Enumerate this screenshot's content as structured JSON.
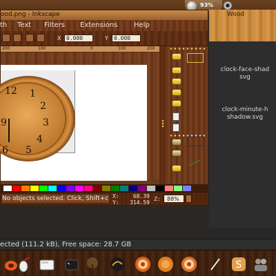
{
  "top_panel": {
    "battery_percent": "93%",
    "accent": "#6a4222"
  },
  "wood_window": {
    "title": "Wood",
    "files": [
      {
        "line1": "clock-face-shad",
        "line2": "svg"
      },
      {
        "line1": "clock-minute-h",
        "line2": "shadow.svg"
      }
    ]
  },
  "inkscape": {
    "title": "ood.png - Inkscape",
    "menu": [
      "th",
      "Text",
      "Filters",
      "Extensions",
      "Help"
    ],
    "toolbar": {
      "x_label": "X",
      "x_value": "0.000",
      "y_label": "Y",
      "y_value": "0.000"
    },
    "ruler": {
      "ticks": [
        "200",
        "100",
        "0",
        "100",
        "200"
      ]
    },
    "clock": {
      "numbers": [
        "12",
        "1",
        "2",
        "3",
        "4",
        "5",
        "6",
        "9"
      ]
    },
    "palette": [
      "#ffffff",
      "#ff0000",
      "#ff8000",
      "#ffff00",
      "#00ff00",
      "#00ffff",
      "#0000ff",
      "#8000ff",
      "#ff00ff",
      "#ff0080",
      "#800000",
      "#808000",
      "#008000",
      "#008080",
      "#000080",
      "#800080",
      "#c0c0c0",
      "#000000",
      "#ff8080",
      "#80ff80",
      "#8080ff"
    ],
    "status": {
      "message": "No objects selected. Click, Shift+click, or drag around objects to select.",
      "x_label": "X:",
      "x_value": "68.39",
      "y_label": "Y:",
      "y_value": "314.59",
      "zoom_label": "Z:",
      "zoom_value": "88%"
    }
  },
  "nautilus": {
    "status": "ected (111.2 kB), Free space: 28.7 GB"
  },
  "dock": {
    "items": [
      "mouse-icon",
      "drive-icon",
      "wood-plant-icon",
      "orange-disc-icon",
      "orange-disc-icon",
      "orange-disc-icon",
      "skype-icon",
      "people-icon"
    ]
  }
}
